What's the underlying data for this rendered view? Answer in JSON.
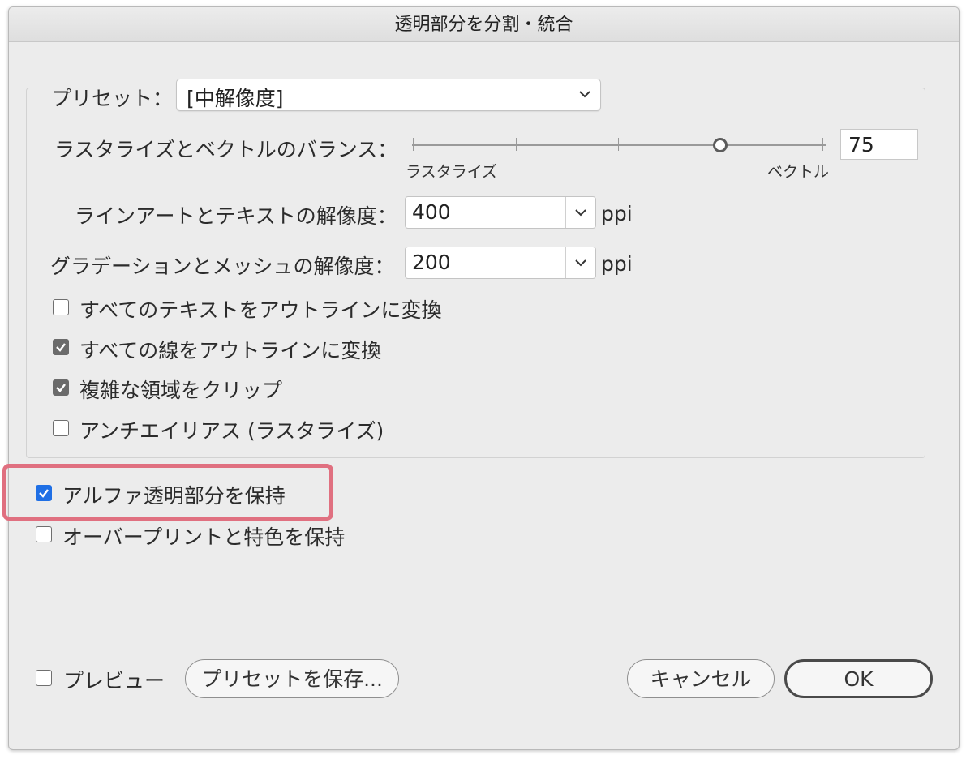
{
  "window": {
    "title": "透明部分を分割・統合"
  },
  "preset": {
    "label": "プリセット：",
    "value": "[中解像度]"
  },
  "balance": {
    "label": "ラスタライズとベクトルのバランス：",
    "value": "75",
    "value_fraction": 0.75,
    "left_label": "ラスタライズ",
    "right_label": "ベクトル"
  },
  "lineart": {
    "label": "ラインアートとテキストの解像度：",
    "value": "400",
    "unit": "ppi"
  },
  "gradient": {
    "label": "グラデーションとメッシュの解像度：",
    "value": "200",
    "unit": "ppi"
  },
  "options": [
    {
      "label": "すべてのテキストをアウトラインに変換",
      "checked": false
    },
    {
      "label": "すべての線をアウトラインに変換",
      "checked": true
    },
    {
      "label": "複雑な領域をクリップ",
      "checked": true
    },
    {
      "label": "アンチエイリアス (ラスタライズ)",
      "checked": false
    }
  ],
  "alpha": {
    "label": "アルファ透明部分を保持",
    "checked": true
  },
  "overprint": {
    "label": "オーバープリントと特色を保持",
    "checked": false
  },
  "preview": {
    "label": "プレビュー",
    "checked": false
  },
  "buttons": {
    "save_preset": "プリセットを保存...",
    "cancel": "キャンセル",
    "ok": "OK"
  },
  "colors": {
    "accent": "#1f6fe5",
    "highlight": "#e07080",
    "dialog_bg": "#ececec"
  }
}
